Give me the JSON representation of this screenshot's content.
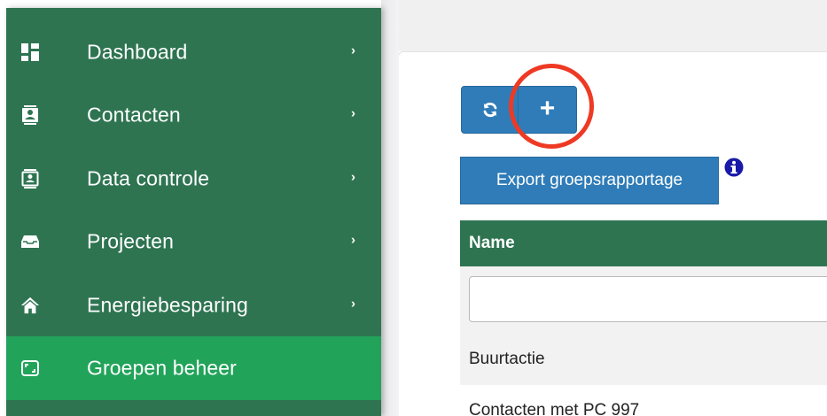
{
  "sidebar": {
    "items": [
      {
        "label": "Dashboard",
        "icon": "dashboard-icon",
        "active": false,
        "has_chevron": true
      },
      {
        "label": "Contacten",
        "icon": "contact-card-icon",
        "active": false,
        "has_chevron": true
      },
      {
        "label": "Data controle",
        "icon": "data-check-icon",
        "active": false,
        "has_chevron": true
      },
      {
        "label": "Projecten",
        "icon": "inbox-tray-icon",
        "active": false,
        "has_chevron": true
      },
      {
        "label": "Energiebesparing",
        "icon": "home-icon",
        "active": false,
        "has_chevron": true
      },
      {
        "label": "Groepen beheer",
        "icon": "groups-frame-icon",
        "active": true,
        "has_chevron": false
      }
    ],
    "chevron_glyph": "›"
  },
  "toolbar": {
    "refresh_icon": "refresh-icon",
    "add_glyph": "+",
    "export_label": "Export groepsrapportage",
    "info_icon": "info-icon"
  },
  "table": {
    "header": "Name",
    "filter_value": "",
    "rows": [
      {
        "name": "Buurtactie"
      },
      {
        "name": "Contacten met PC 997"
      }
    ]
  },
  "colors": {
    "sidebar_bg": "#2e7451",
    "sidebar_active": "#22a35a",
    "button_blue": "#2f7cb8",
    "highlight_red": "#ee3a24",
    "info_blue": "#1a1aa8"
  }
}
